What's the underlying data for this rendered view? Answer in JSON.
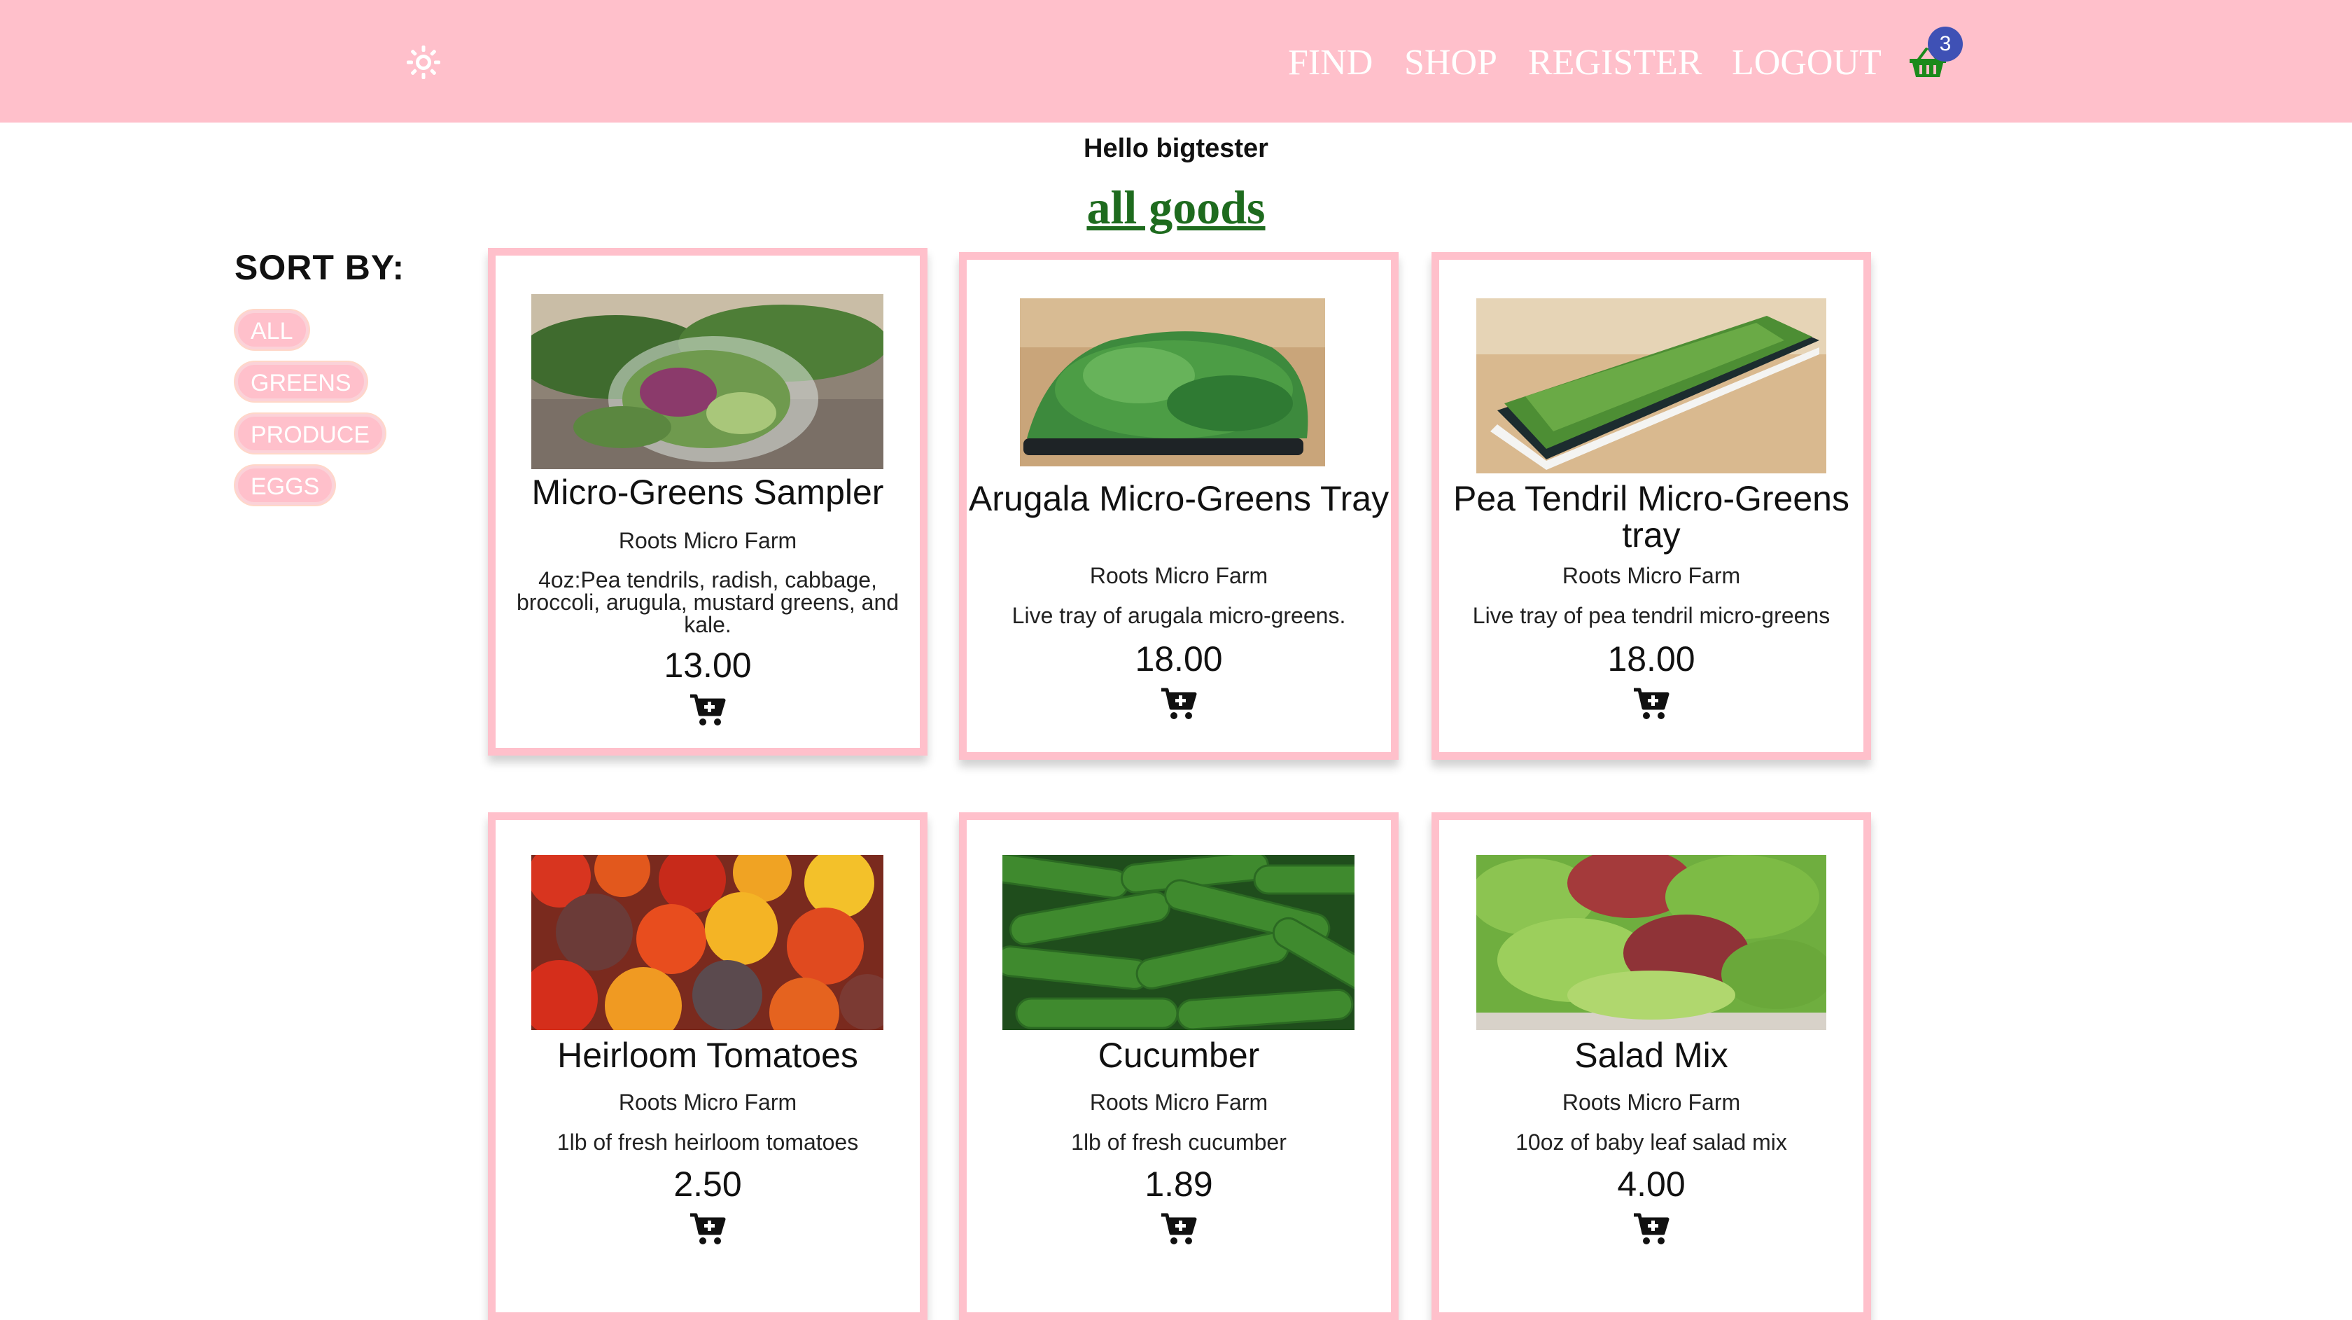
{
  "header": {
    "nav": [
      "FIND",
      "SHOP",
      "REGISTER",
      "LOGOUT"
    ],
    "cart_count": "3",
    "colors": {
      "bar": "#ffc0cb",
      "badge": "#3f51b5",
      "basket": "#1b8a1b"
    }
  },
  "greeting": "Hello bigtester",
  "title": "all goods",
  "sort": {
    "label": "SORT BY:",
    "options": [
      "ALL",
      "GREENS",
      "PRODUCE",
      "EGGS"
    ]
  },
  "products": [
    {
      "name": "Micro-Greens Sampler",
      "farm": "Roots Micro Farm",
      "desc": "4oz:Pea tendrils, radish, cabbage, broccoli, arugula, mustard greens, and kale.",
      "price": "13.00",
      "image": "micro-greens-sampler"
    },
    {
      "name": "Arugala Micro-Greens Tray",
      "farm": "Roots Micro Farm",
      "desc": "Live tray of arugala micro-greens.",
      "price": "18.00",
      "image": "arugala-tray"
    },
    {
      "name": "Pea Tendril Micro-Greens tray",
      "farm": "Roots Micro Farm",
      "desc": "Live tray of pea tendril micro-greens",
      "price": "18.00",
      "image": "pea-tendril-tray"
    },
    {
      "name": "Heirloom Tomatoes",
      "farm": "Roots Micro Farm",
      "desc": "1lb of fresh heirloom tomatoes",
      "price": "2.50",
      "image": "heirloom-tomatoes"
    },
    {
      "name": "Cucumber",
      "farm": "Roots Micro Farm",
      "desc": "1lb of fresh cucumber",
      "price": "1.89",
      "image": "cucumbers"
    },
    {
      "name": "Salad Mix",
      "farm": "Roots Micro Farm",
      "desc": "10oz of baby leaf salad mix",
      "price": "4.00",
      "image": "salad-mix"
    }
  ]
}
